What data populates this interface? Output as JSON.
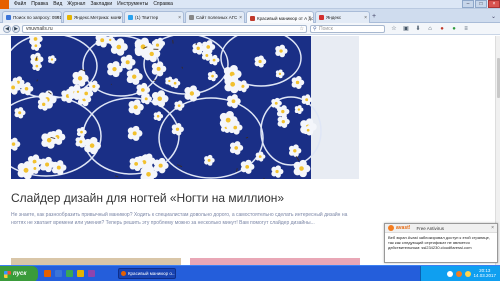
{
  "colors": {
    "menubar": "#dbe6f5",
    "taskbar": "#245edb",
    "start": "#3a9b3a",
    "nail_background": "#1a2f86",
    "article_title": "#333333",
    "article_text": "#7b86a6",
    "avast_orange": "#e56a12"
  },
  "menu": {
    "items": [
      "Файл",
      "Правка",
      "Вид",
      "Журнал",
      "Закладки",
      "Инструменты",
      "Справка"
    ]
  },
  "window_controls": {
    "minimize": "–",
    "maximize": "□",
    "close": "×"
  },
  "tabs": [
    {
      "label": "Поиск по запросу: 05911",
      "icon_color": "#3b74d8"
    },
    {
      "label": "Яндекс.Метрика: мониторинг",
      "icon_color": "#e5b400"
    },
    {
      "label": "(1) Твиттер",
      "icon_color": "#2aa3ef"
    },
    {
      "label": "Сайт полезных АГС",
      "icon_color": "#888888"
    },
    {
      "label": "Красивый маникюр от А до Я",
      "icon_color": "#c0392b"
    },
    {
      "label": "Яндекс",
      "icon_color": "#d32f2f"
    }
  ],
  "tab_add": "+",
  "tab_scroll": "⌄",
  "nav": {
    "back": "◀",
    "forward": "▶",
    "url": "vnuvnails.ru",
    "url_star": "☆",
    "search_placeholder": "Поиск",
    "search_glass": "⚲",
    "tools": [
      "☆",
      "▣",
      "⬇",
      "⌂",
      "●",
      "●",
      "≡"
    ]
  },
  "article": {
    "title": "Слайдер дизайн для ногтей «Ногти на миллион»",
    "text": "Не знаете, как разнообразить привычный маникюр? Ходить к специалистам довольно дорого, а самостоятельно сделать интересный дизайн на ногтях не хватает времени или умения? Теперь решить эту проблему можно за несколько минут! Вам помогут слайдер дизайны..."
  },
  "popup": {
    "brand": "avast!",
    "title": "Free Antivirus",
    "close": "×",
    "body": "Веб экран Avast заблокировал доступ к этой странице, так как следующий сертификат не является действительным: ssl234230.cloudflaressl.com"
  },
  "taskbar": {
    "start_label": "пуск",
    "task_label": "Красивый маникюр о...",
    "quick_colors": [
      "#e66000",
      "#3b74d8",
      "#3aa655",
      "#e5b400",
      "#8e44ad"
    ]
  },
  "tray": {
    "time": "20:13",
    "date": "14.03.2017",
    "icon_colors": [
      "#ffffff",
      "#f47d20",
      "#ffd54f"
    ]
  }
}
